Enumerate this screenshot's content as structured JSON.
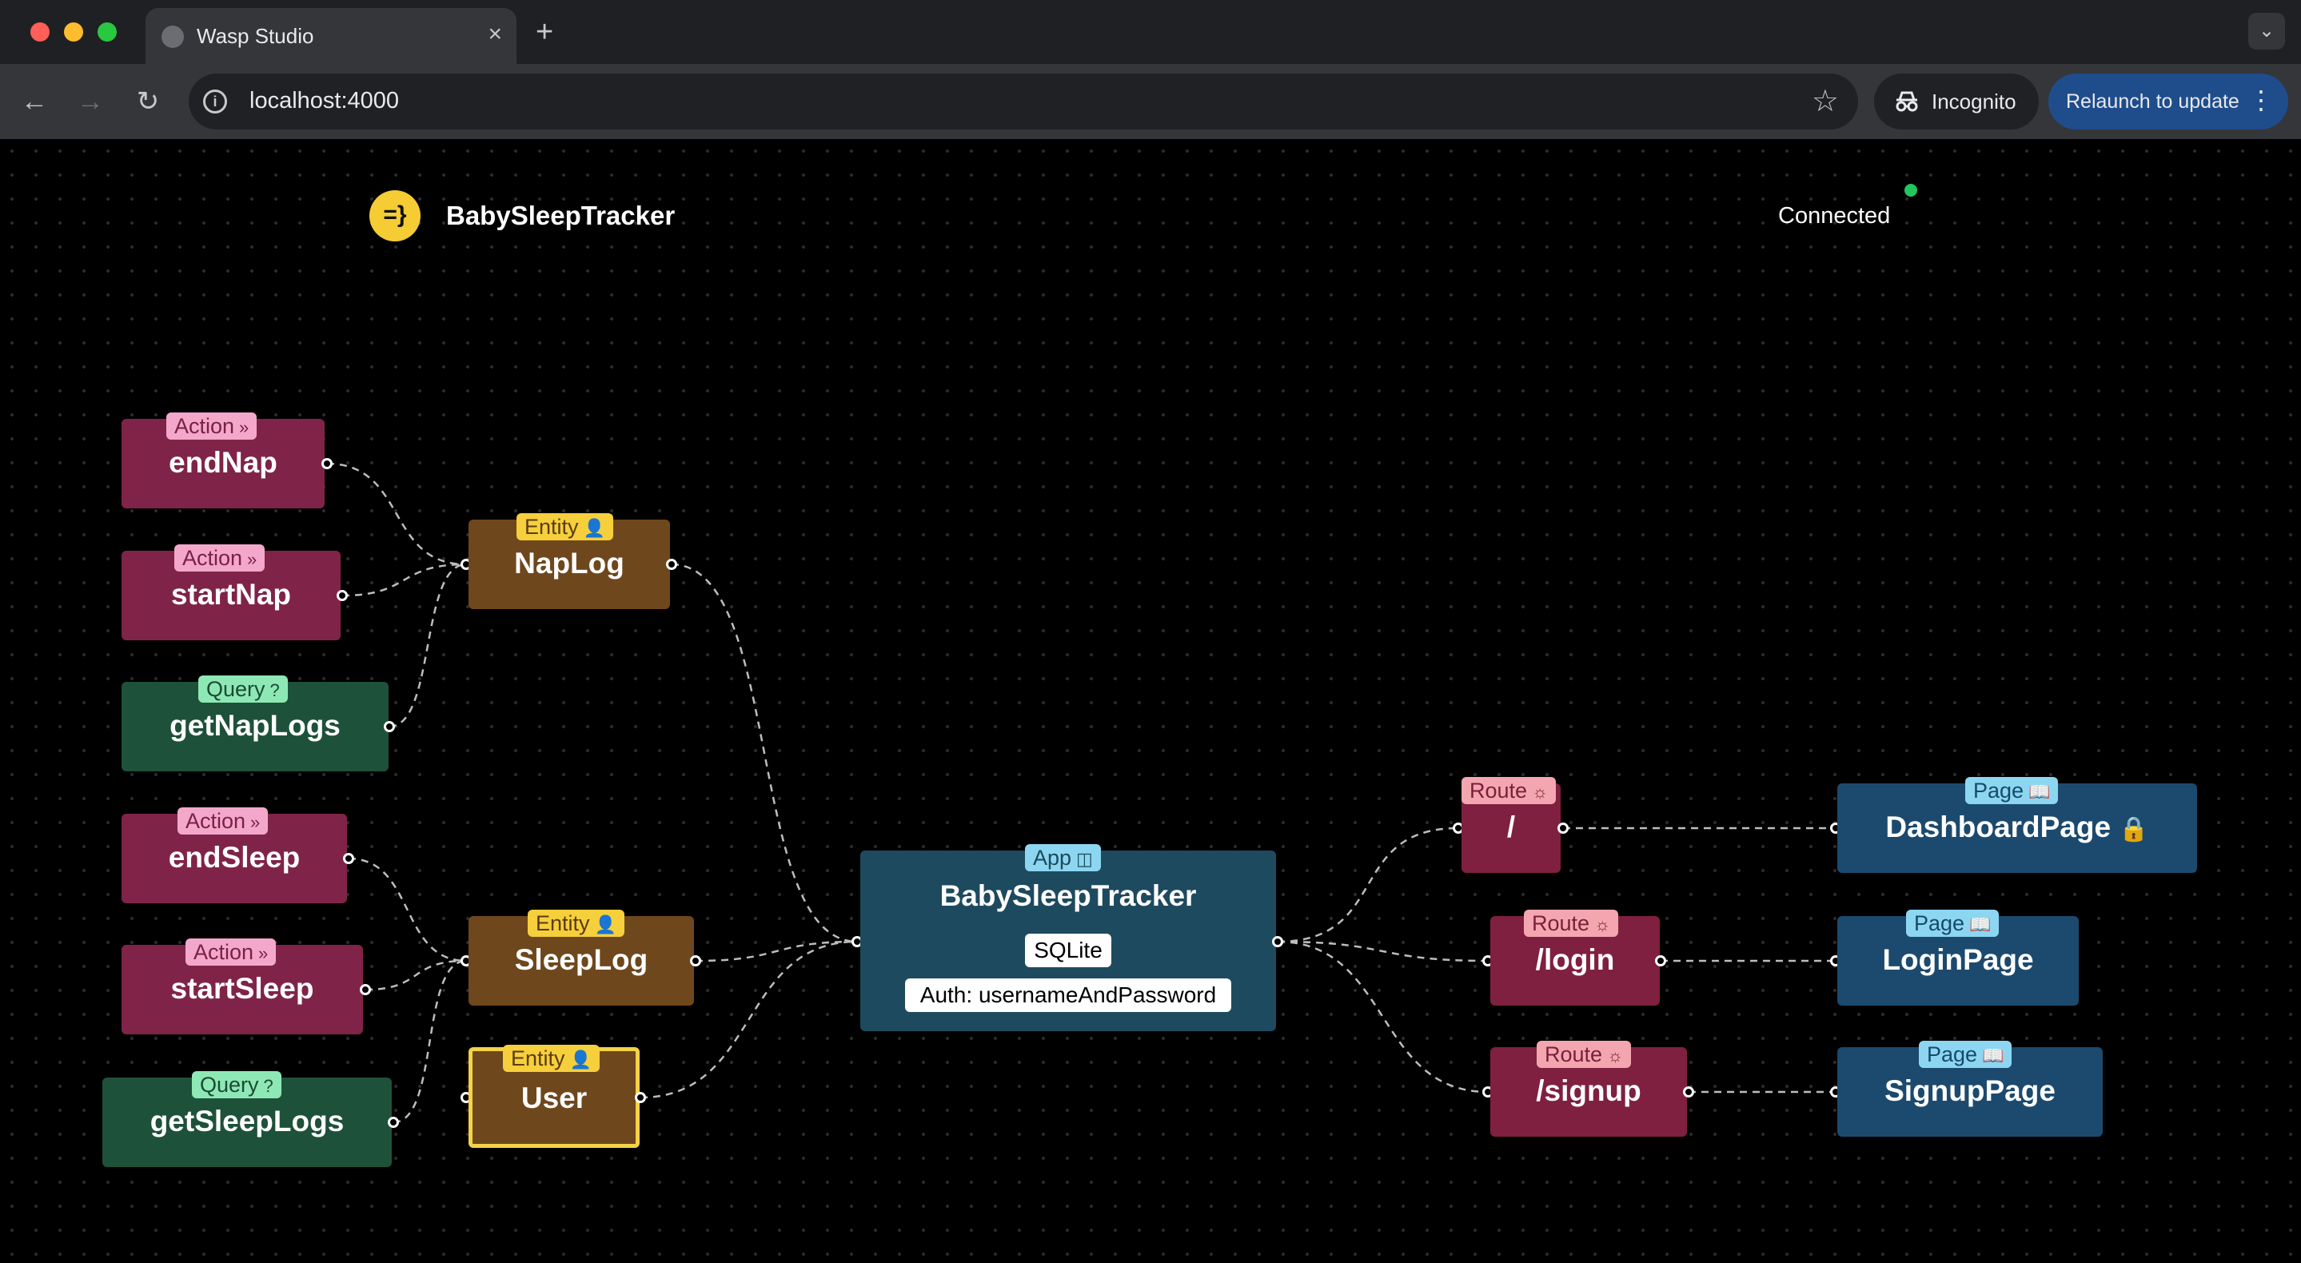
{
  "browser": {
    "tab_title": "Wasp Studio",
    "tab_close": "×",
    "new_tab": "+",
    "url": "localhost:4000",
    "incognito_label": "Incognito",
    "relaunch_label": "Relaunch to update",
    "relaunch_menu": "⋮",
    "back": "←",
    "forward": "→",
    "reload": "↻",
    "star": "☆",
    "tabs_menu": "⌄",
    "info": "i"
  },
  "header": {
    "logo_text": "=}",
    "app_name": "BabySleepTracker",
    "status_text": "Connected",
    "status_color": "#22c55e"
  },
  "nodes": {
    "endNap": {
      "type": "Action",
      "icon": "»",
      "label": "endNap"
    },
    "startNap": {
      "type": "Action",
      "icon": "»",
      "label": "startNap"
    },
    "getNapLogs": {
      "type": "Query",
      "icon": "?",
      "label": "getNapLogs"
    },
    "endSleep": {
      "type": "Action",
      "icon": "»",
      "label": "endSleep"
    },
    "startSleep": {
      "type": "Action",
      "icon": "»",
      "label": "startSleep"
    },
    "getSleepLogs": {
      "type": "Query",
      "icon": "?",
      "label": "getSleepLogs"
    },
    "napLog": {
      "type": "Entity",
      "icon": "👤",
      "label": "NapLog"
    },
    "sleepLog": {
      "type": "Entity",
      "icon": "👤",
      "label": "SleepLog"
    },
    "user": {
      "type": "Entity",
      "icon": "👤",
      "label": "User"
    },
    "app": {
      "type": "App",
      "icon": "◫",
      "label": "BabySleepTracker",
      "db": "SQLite",
      "auth": "Auth: usernameAndPassword"
    },
    "routeRoot": {
      "type": "Route",
      "icon": "☼",
      "label": "/"
    },
    "routeLogin": {
      "type": "Route",
      "icon": "☼",
      "label": "/login"
    },
    "routeSignup": {
      "type": "Route",
      "icon": "☼",
      "label": "/signup"
    },
    "dashboardPage": {
      "type": "Page",
      "icon": "📖",
      "label": "DashboardPage",
      "lock": "🔒"
    },
    "loginPage": {
      "type": "Page",
      "icon": "📖",
      "label": "LoginPage"
    },
    "signupPage": {
      "type": "Page",
      "icon": "📖",
      "label": "SignupPage"
    }
  }
}
